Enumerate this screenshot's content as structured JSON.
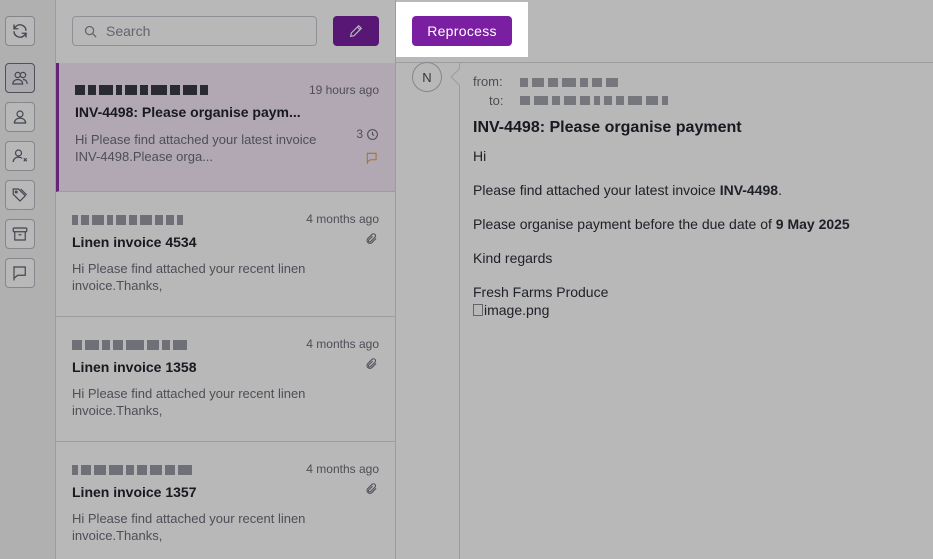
{
  "search": {
    "placeholder": "Search"
  },
  "toolbar": {
    "reprocess_label": "Reprocess"
  },
  "messages": [
    {
      "time": "19 hours ago",
      "subject": "INV-4498: Please organise paym...",
      "preview": "Hi Please find attached your latest invoice INV-4498.Please orga...",
      "count": "3",
      "selected": true
    },
    {
      "time": "4 months ago",
      "subject": "Linen invoice 4534",
      "preview": "Hi Please find attached your recent linen invoice.Thanks,"
    },
    {
      "time": "4 months ago",
      "subject": "Linen invoice 1358",
      "preview": "Hi Please find attached your recent linen invoice.Thanks,"
    },
    {
      "time": "4 months ago",
      "subject": "Linen invoice 1357",
      "preview": "Hi Please find attached your recent linen invoice.Thanks,"
    }
  ],
  "detail": {
    "avatar_initial": "N",
    "from_label": "from:",
    "to_label": "to:",
    "subject": "INV-4498: Please organise payment",
    "greeting": "Hi",
    "line1_prefix": "Please find attached your latest invoice ",
    "line1_invoice": "INV-4498",
    "line1_suffix": ".",
    "line2_prefix": "Please organise payment before the due date of ",
    "line2_date": "9 May 2025",
    "regards": "Kind regards",
    "company": "Fresh Farms Produce",
    "image_alt": "image.png"
  },
  "colors": {
    "accent": "#7b1fa2",
    "flag": "#e0a72b",
    "selected_bg": "#f6e9f8"
  },
  "icons": [
    "refresh-icon",
    "users-icon",
    "user-icon",
    "user-remove-icon",
    "tags-icon",
    "archive-icon",
    "flag-icon",
    "search-icon",
    "pencil-icon",
    "paperclip-icon",
    "clock-icon"
  ]
}
